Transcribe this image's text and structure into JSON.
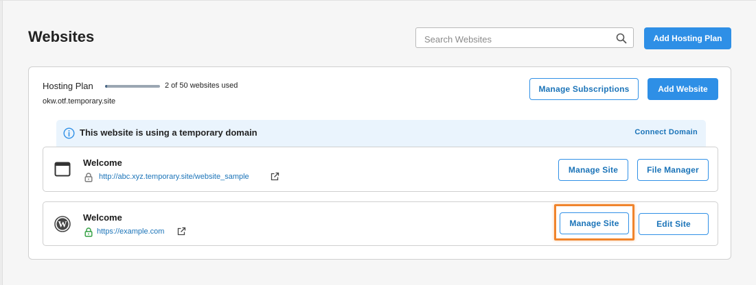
{
  "page": {
    "title": "Websites",
    "search_placeholder": "Search Websites",
    "add_hosting_label": "Add Hosting Plan"
  },
  "plan": {
    "label": "Hosting Plan",
    "usage_text": "2 of 50 websites used",
    "usage_fraction": 0.04,
    "domain": "okw.otf.temporary.site",
    "manage_subscriptions_label": "Manage Subscriptions",
    "add_website_label": "Add Website"
  },
  "banner": {
    "text": "This website is using a temporary domain",
    "link_label": "Connect Domain"
  },
  "sites": [
    {
      "icon": "browser-window-icon",
      "title": "Welcome",
      "url": "http://abc.xyz.temporary.site/website_sample",
      "lock_status": "insecure",
      "primary_label": "Manage Site",
      "secondary_label": "File Manager"
    },
    {
      "icon": "wordpress-icon",
      "title": "Welcome",
      "url": "https://example.com",
      "lock_status": "secure",
      "primary_label": "Manage Site",
      "secondary_label": "Edit Site"
    }
  ],
  "colors": {
    "accent": "#2e8fe6",
    "link": "#1a73b8",
    "highlight": "#f0842c",
    "secure_lock": "#2e9e3e",
    "insecure_lock": "#777777"
  }
}
